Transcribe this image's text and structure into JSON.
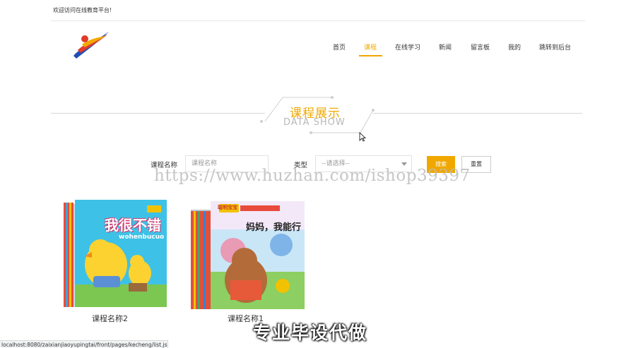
{
  "header": {
    "welcome": "欢迎访问在线教育平台!"
  },
  "nav": {
    "items": [
      {
        "label": "首页",
        "active": false
      },
      {
        "label": "课程",
        "active": true
      },
      {
        "label": "在线学习",
        "active": false
      },
      {
        "label": "新闻",
        "active": false
      },
      {
        "label": "留言板",
        "active": false
      },
      {
        "label": "我的",
        "active": false
      },
      {
        "label": "跳转到后台",
        "active": false
      }
    ]
  },
  "section": {
    "title": "课程展示",
    "subtitle": "DATA SHOW"
  },
  "search": {
    "name_label": "课程名称",
    "name_placeholder": "课程名称",
    "type_label": "类型",
    "type_selected": "--请选择--",
    "search_label": "搜索",
    "reset_label": "重置"
  },
  "courses": [
    {
      "name": "课程名称2",
      "cover_title": "我很不错",
      "cover_sub": "wohenbucuo"
    },
    {
      "name": "课程名称1",
      "cover_title": "妈妈，我能行",
      "cover_badge": "聪明宝宝"
    }
  ],
  "overlay": {
    "watermark": "https://www.huzhan.com/ishop39397",
    "caption": "专业毕设代做"
  },
  "status_bar": {
    "url": "localhost:8080/zaixianjiaoyupingtai/front/pages/kecheng/list.jsp#"
  },
  "colors": {
    "accent": "#f0a800",
    "text": "#333333"
  }
}
